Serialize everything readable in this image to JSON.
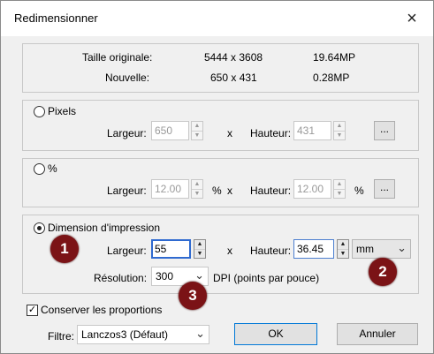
{
  "window": {
    "title": "Redimensionner",
    "close_icon": "×"
  },
  "info": {
    "original_label": "Taille originale:",
    "original_size": "5444 x 3608",
    "original_mp": "19.64MP",
    "new_label": "Nouvelle:",
    "new_size": "650 x 431",
    "new_mp": "0.28MP"
  },
  "pixels": {
    "label": "Pixels",
    "width_label": "Largeur:",
    "width_value": "650",
    "x": "x",
    "height_label": "Hauteur:",
    "height_value": "431",
    "dots": "..."
  },
  "percent": {
    "label": "%",
    "width_label": "Largeur:",
    "width_value": "12.00",
    "unit1": "%",
    "x": "x",
    "height_label": "Hauteur:",
    "height_value": "12.00",
    "unit2": "%",
    "dots": "..."
  },
  "print": {
    "label": "Dimension d'impression",
    "width_label": "Largeur:",
    "width_value": "55",
    "x": "x",
    "height_label": "Hauteur:",
    "height_value": "36.45",
    "unit": "mm",
    "resolution_label": "Résolution:",
    "resolution_value": "300",
    "resolution_unit": "DPI (points par pouce)"
  },
  "keep_proportions": {
    "label": "Conserver les proportions",
    "checked": true,
    "check_mark": "✓"
  },
  "filter": {
    "label": "Filtre:",
    "value": "Lanczos3 (Défaut)"
  },
  "buttons": {
    "ok": "OK",
    "cancel": "Annuler"
  },
  "annotations": [
    "1",
    "2",
    "3"
  ],
  "glyphs": {
    "up": "▲",
    "down": "▼",
    "chevron": "⌄"
  },
  "colors": {
    "badge": "#7b1316",
    "focus_border": "#2f6ad0",
    "ok_border": "#0078d7"
  }
}
